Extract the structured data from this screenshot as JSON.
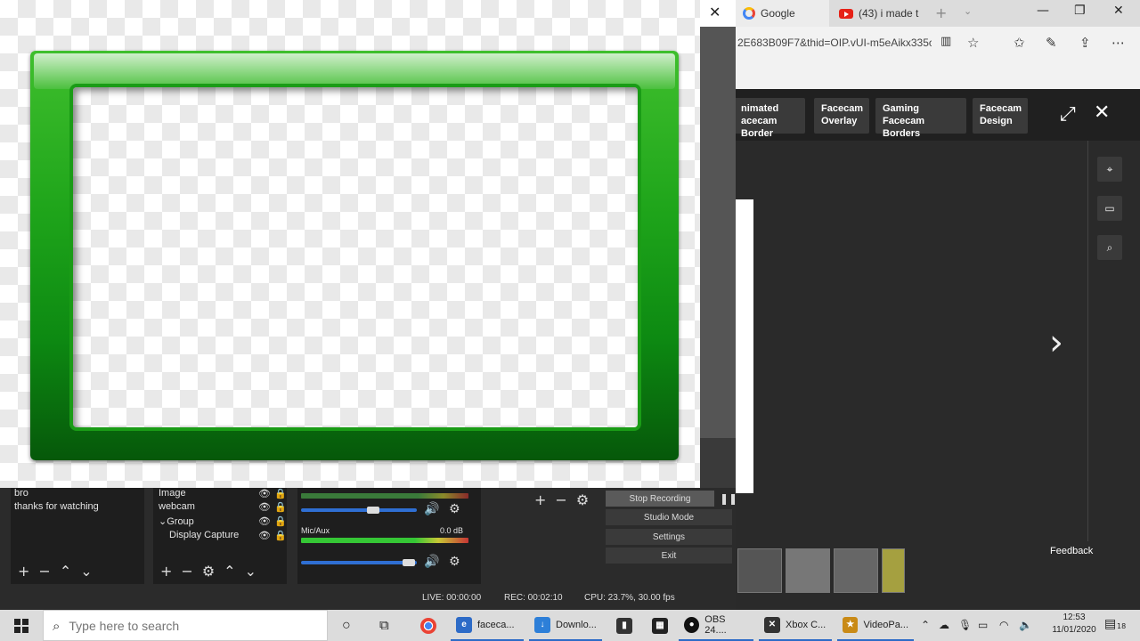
{
  "preview": {
    "close_icon": "close-icon"
  },
  "browser": {
    "tabs": [
      {
        "label": "Google",
        "icon": "google-icon"
      },
      {
        "label": "(43) i made t",
        "icon": "youtube-icon"
      }
    ],
    "url": "2E683B09F7&thid=OIP.vUI-m5eAikx335c",
    "viewer": {
      "chips": [
        {
          "line1": "nimated",
          "line2": "acecam Border"
        },
        {
          "line1": "Facecam",
          "line2": "Overlay"
        },
        {
          "line1": "Gaming",
          "line2": "Facecam Borders"
        },
        {
          "line1": "Facecam",
          "line2": "Design"
        }
      ],
      "feedback": "Feedback"
    }
  },
  "obs": {
    "scenes": [
      "bro",
      "thanks for watching"
    ],
    "sources": [
      "Image",
      "webcam",
      "Group",
      "Display Capture"
    ],
    "mixer": {
      "mic_label": "Mic/Aux",
      "mic_db": "0.0 dB"
    },
    "controls": [
      "Stop Recording",
      "Studio Mode",
      "Settings",
      "Exit"
    ],
    "status": {
      "live": "LIVE: 00:00:00",
      "rec": "REC: 00:02:10",
      "cpu": "CPU: 23.7%, 30.00 fps"
    }
  },
  "taskbar": {
    "search_placeholder": "Type here to search",
    "apps": [
      {
        "label": "faceca...",
        "icon": "edge-icon"
      },
      {
        "label": "Downlo...",
        "icon": "download-icon"
      },
      {
        "label": "OBS 24....",
        "icon": "obs-icon"
      },
      {
        "label": "Xbox C...",
        "icon": "xbox-icon"
      },
      {
        "label": "VideoPa...",
        "icon": "videopad-icon"
      }
    ],
    "time": "12:53",
    "date": "11/01/2020",
    "notification_count": "18"
  }
}
